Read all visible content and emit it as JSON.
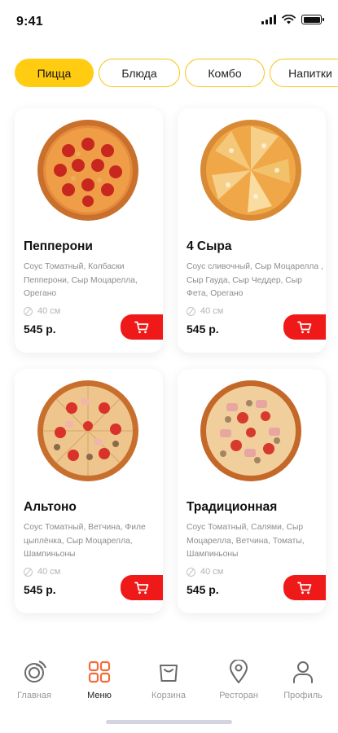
{
  "status_bar": {
    "time": "9:41"
  },
  "tabs": [
    {
      "label": "Пицца",
      "active": true
    },
    {
      "label": "Блюда",
      "active": false
    },
    {
      "label": "Комбо",
      "active": false
    },
    {
      "label": "Напитки",
      "active": false
    }
  ],
  "products": [
    {
      "name": "Пепперони",
      "description": "Соус Томатный, Колбаски Пепперони, Сыр Моцарелла, Орегано",
      "size": "40 см",
      "price": "545 р."
    },
    {
      "name": "4 Сыра",
      "description": "Соус сливочный, Сыр Моцарелла , Сыр Гауда, Сыр Чеддер, Сыр Фета, Орегано",
      "size": "40 см",
      "price": "545 р."
    },
    {
      "name": "Альтоно",
      "description": "Соус Томатный, Ветчина, Филе цыплёнка, Сыр Моцарелла, Шампиньоны",
      "size": "40 см",
      "price": "545 р."
    },
    {
      "name": "Традиционная",
      "description": "Соус Томатный, Салями, Сыр Моцарелла, Ветчина, Томаты, Шампиньоны",
      "size": "40 см",
      "price": "545 р."
    }
  ],
  "bottom_nav": [
    {
      "label": "Главная",
      "icon": "home-icon",
      "active": false
    },
    {
      "label": "Меню",
      "icon": "menu-grid-icon",
      "active": true
    },
    {
      "label": "Корзина",
      "icon": "basket-icon",
      "active": false
    },
    {
      "label": "Ресторан",
      "icon": "location-pin-icon",
      "active": false
    },
    {
      "label": "Профиль",
      "icon": "profile-icon",
      "active": false
    }
  ],
  "colors": {
    "accent_yellow": "#ffcc12",
    "cart_red": "#f01919",
    "active_nav_orange": "#f26b3a"
  }
}
